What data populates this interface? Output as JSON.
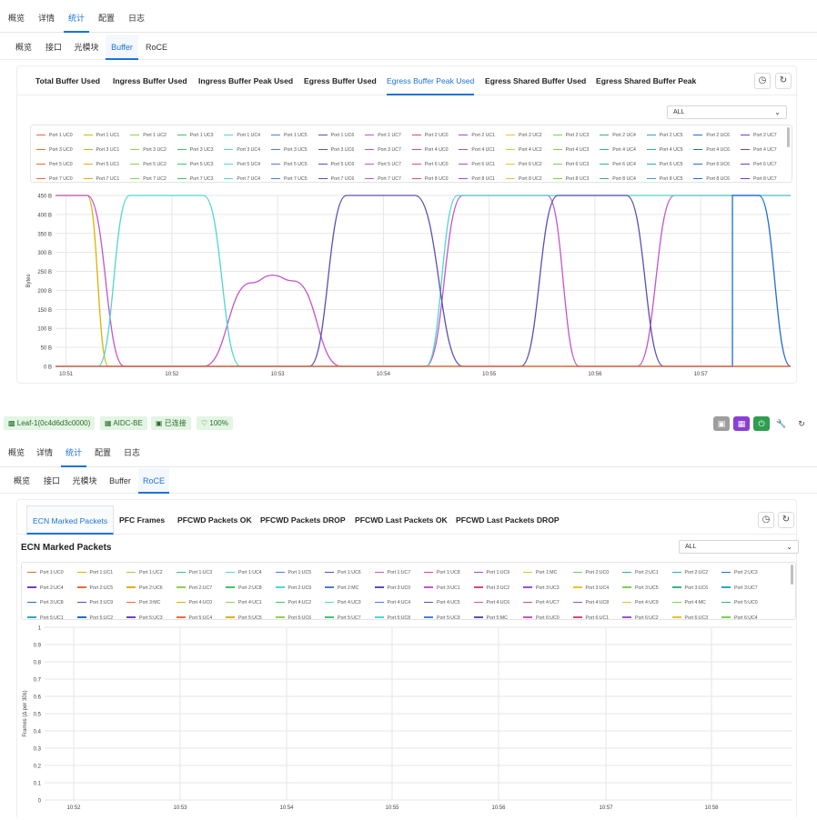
{
  "top": {
    "nav": [
      "概览",
      "详情",
      "统计",
      "配置",
      "日志"
    ],
    "nav_active": 2,
    "subnav": [
      "概览",
      "接口",
      "光模块",
      "Buffer",
      "RoCE"
    ],
    "subnav_active": 3,
    "tabs": [
      "Total Buffer Used",
      "Ingress Buffer Used",
      "Ingress Buffer Peak Used",
      "Egress Buffer Used",
      "Egress Buffer Peak Used",
      "Egress Shared Buffer Used",
      "Egress Shared Buffer Peak"
    ],
    "tab_active": 4,
    "filter_value": "ALL",
    "legend": [
      "Port 1 UC0",
      "Port 1 UC1",
      "Port 1 UC2",
      "Port 1 UC3",
      "Port 1 UC4",
      "Port 1 UC5",
      "Port 1 UC6",
      "Port 1 UC7",
      "Port 2 UC0",
      "Port 2 UC1",
      "Port 2 UC2",
      "Port 2 UC3",
      "Port 2 UC4",
      "Port 2 UC5",
      "Port 2 UC6",
      "Port 2 UC7",
      "Port 3 UC0",
      "Port 3 UC1",
      "Port 3 UC2",
      "Port 3 UC3",
      "Port 3 UC4",
      "Port 3 UC5",
      "Port 3 UC6",
      "Port 3 UC7",
      "Port 4 UC0",
      "Port 4 UC1",
      "Port 4 UC2",
      "Port 4 UC3",
      "Port 4 UC4",
      "Port 4 UC5",
      "Port 4 UC6",
      "Port 4 UC7",
      "Port 5 UC0",
      "Port 5 UC1",
      "Port 5 UC2",
      "Port 5 UC3",
      "Port 5 UC4",
      "Port 5 UC5",
      "Port 5 UC6",
      "Port 5 UC7",
      "Port 6 UC0",
      "Port 6 UC1",
      "Port 6 UC2",
      "Port 6 UC3",
      "Port 6 UC4",
      "Port 6 UC5",
      "Port 6 UC6",
      "Port 6 UC7",
      "Port 7 UC0",
      "Port 7 UC1",
      "Port 7 UC2",
      "Port 7 UC3",
      "Port 7 UC4",
      "Port 7 UC5",
      "Port 7 UC6",
      "Port 7 UC7",
      "Port 8 UC0",
      "Port 8 UC1",
      "Port 8 UC2",
      "Port 8 UC3",
      "Port 8 UC4",
      "Port 8 UC5",
      "Port 8 UC6",
      "Port 8 UC7"
    ],
    "chart_data": {
      "type": "line",
      "ylabel": "Bytes",
      "y_ticks": [
        "0 B",
        "50 B",
        "100 B",
        "150 B",
        "200 B",
        "250 B",
        "300 B",
        "350 B",
        "400 B",
        "450 B"
      ],
      "ylim": [
        0,
        450
      ],
      "x_ticks": [
        "10:51",
        "10:52",
        "10:53",
        "10:54",
        "10:55",
        "10:56",
        "10:57"
      ],
      "xlim_minutes": [
        50.9,
        57.85
      ],
      "series": [
        {
          "color": "#e0b000",
          "points": [
            [
              50.9,
              450
            ],
            [
              51.2,
              450
            ],
            [
              51.4,
              0
            ],
            [
              57.85,
              0
            ]
          ]
        },
        {
          "color": "#c455cc",
          "points": [
            [
              50.9,
              450
            ],
            [
              51.2,
              450
            ],
            [
              51.55,
              0
            ],
            [
              52.3,
              0
            ],
            [
              52.75,
              220
            ],
            [
              52.95,
              240
            ],
            [
              53.15,
              225
            ],
            [
              53.6,
              0
            ],
            [
              54.4,
              0
            ],
            [
              54.75,
              450
            ],
            [
              55.55,
              450
            ],
            [
              55.85,
              0
            ],
            [
              56.4,
              0
            ],
            [
              56.75,
              450
            ],
            [
              57.85,
              450
            ]
          ]
        },
        {
          "color": "#4fd6d0",
          "points": [
            [
              50.9,
              0
            ],
            [
              51.3,
              0
            ],
            [
              51.6,
              450
            ],
            [
              52.3,
              450
            ],
            [
              52.65,
              0
            ],
            [
              53.3,
              0
            ],
            [
              53.65,
              0
            ],
            [
              54.4,
              0
            ],
            [
              54.7,
              450
            ],
            [
              57.85,
              450
            ]
          ]
        },
        {
          "color": "#5b4fb5",
          "points": [
            [
              50.9,
              0
            ],
            [
              53.3,
              0
            ],
            [
              53.65,
              450
            ],
            [
              54.3,
              450
            ],
            [
              54.75,
              0
            ],
            [
              55.3,
              0
            ],
            [
              55.65,
              450
            ],
            [
              56.3,
              450
            ],
            [
              56.65,
              0
            ],
            [
              57.85,
              0
            ]
          ]
        },
        {
          "color": "#1e6bd6",
          "points": [
            [
              50.9,
              0
            ],
            [
              57.3,
              0
            ],
            [
              57.3,
              450
            ],
            [
              57.55,
              450
            ],
            [
              57.85,
              0
            ]
          ]
        },
        {
          "color": "#f06a3a",
          "points": [
            [
              50.9,
              0
            ],
            [
              57.85,
              0
            ]
          ]
        }
      ]
    }
  },
  "status": {
    "device": "Leaf-1(0c4d6d3c0000)",
    "site": "AIDC-BE",
    "conn": "已连接",
    "health": "100%"
  },
  "bottom": {
    "nav": [
      "概览",
      "详情",
      "统计",
      "配置",
      "日志"
    ],
    "nav_active": 2,
    "subnav": [
      "概览",
      "接口",
      "光模块",
      "Buffer",
      "RoCE"
    ],
    "subnav_active": 4,
    "tabs": [
      "ECN Marked Packets",
      "PFC Frames",
      "PFCWD Packets OK",
      "PFCWD Packets DROP",
      "PFCWD Last Packets OK",
      "PFCWD Last Packets DROP"
    ],
    "tab_active": 0,
    "section_title": "ECN Marked Packets",
    "filter_value": "ALL",
    "legend": [
      "Port 1:UC0",
      "Port 1:UC1",
      "Port 1:UC2",
      "Port 1:UC3",
      "Port 1:UC4",
      "Port 1:UC5",
      "Port 1:UC6",
      "Port 1:UC7",
      "Port 1:UC8",
      "Port 1:UC9",
      "Port 1:MC",
      "Port 2:UC0",
      "Port 2:UC1",
      "Port 2:UC2",
      "Port 2:UC3",
      "Port 2:UC4",
      "Port 2:UC5",
      "Port 2:UC6",
      "Port 2:UC7",
      "Port 2:UC8",
      "Port 2:UC9",
      "Port 2:MC",
      "Port 3:UC0",
      "Port 3:UC1",
      "Port 3:UC2",
      "Port 3:UC3",
      "Port 3:UC4",
      "Port 3:UC5",
      "Port 3:UC6",
      "Port 3:UC7",
      "Port 3:UC8",
      "Port 3:UC9",
      "Port 3:MC",
      "Port 4:UC0",
      "Port 4:UC1",
      "Port 4:UC2",
      "Port 4:UC3",
      "Port 4:UC4",
      "Port 4:UC5",
      "Port 4:UC6",
      "Port 4:UC7",
      "Port 4:UC8",
      "Port 4:UC9",
      "Port 4:MC",
      "Port 5:UC0",
      "Port 5:UC1",
      "Port 5:UC2",
      "Port 5:UC3",
      "Port 5:UC4",
      "Port 5:UC5",
      "Port 5:UC6",
      "Port 5:UC7",
      "Port 5:UC8",
      "Port 5:UC9",
      "Port 5:MC",
      "Port 6:UC0",
      "Port 6:UC1",
      "Port 6:UC2",
      "Port 6:UC3",
      "Port 6:UC4",
      "Port 6:UC5"
    ],
    "chart_data": {
      "type": "line",
      "ylabel": "Frames (Δ per 30s)",
      "y_ticks": [
        "0",
        "0.1",
        "0.2",
        "0.3",
        "0.4",
        "0.5",
        "0.6",
        "0.7",
        "0.8",
        "0.9",
        "1"
      ],
      "ylim": [
        0,
        1
      ],
      "x_ticks": [
        "10:52",
        "10:53",
        "10:54",
        "10:55",
        "10:56",
        "10:57",
        "10:58"
      ],
      "series": []
    }
  },
  "colors": {
    "accent": "#1a73d9",
    "legend_palette": [
      "#f06a3a",
      "#e0b000",
      "#8fd14f",
      "#3ec46d",
      "#4fd6d0",
      "#4b7de0",
      "#5b4fb5",
      "#c455cc",
      "#e0477a",
      "#9b4fd6",
      "#e4c430",
      "#7ad050",
      "#36b37e",
      "#2aa7c9",
      "#1e6bd6",
      "#6c3fc4"
    ],
    "status_green": "#e3f5e3"
  }
}
